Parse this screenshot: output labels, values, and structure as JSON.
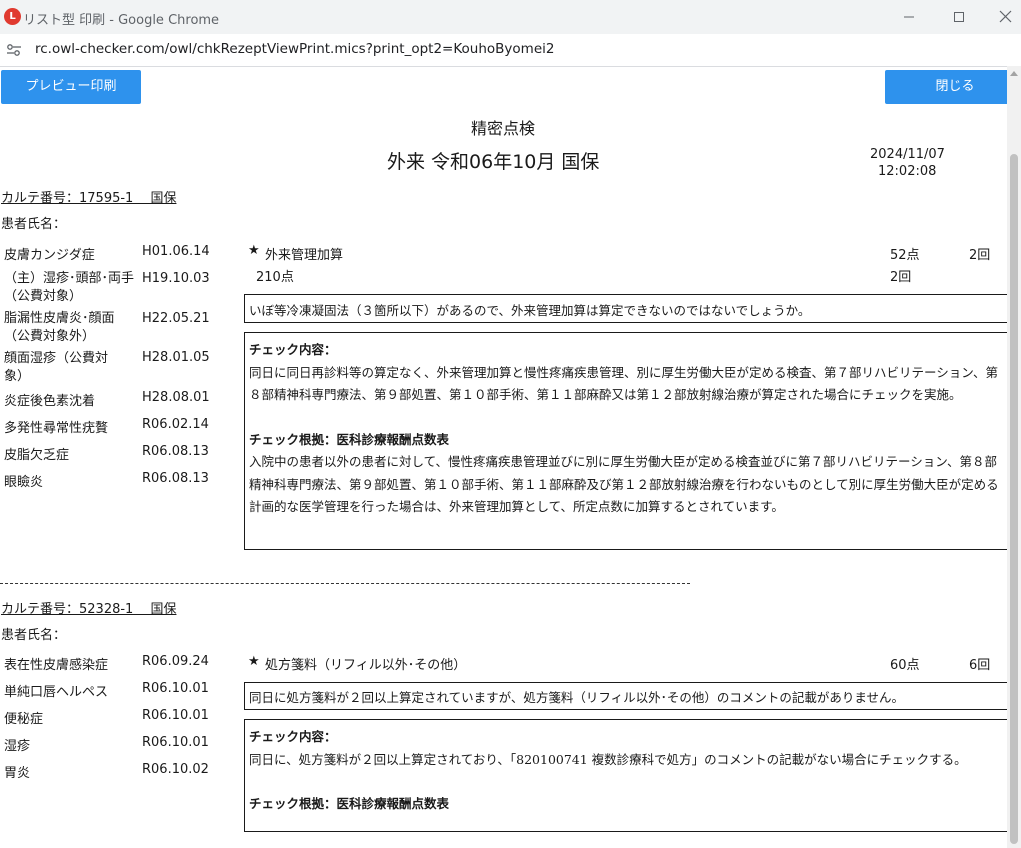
{
  "window": {
    "title": "リスト型 印刷 - Google Chrome",
    "favicon_text": "L"
  },
  "urlbar": {
    "url": "rc.owl-checker.com/owl/chkRezeptViewPrint.mics?print_opt2=KouhoByomei2"
  },
  "toolbar": {
    "preview_label": "プレビュー印刷",
    "close_label": "閉じる"
  },
  "report": {
    "title": "精密点検",
    "subtitle": "外来 令和06年10月 国保",
    "date": "2024/11/07",
    "time": "12:02:08"
  },
  "patients": [
    {
      "karte": "カルテ番号：17595-1　 国保",
      "name_label": "患者氏名：",
      "diseases": [
        {
          "name": "皮膚カンジダ症",
          "date": "H01.06.14"
        },
        {
          "name": "（主）湿疹･頭部･両手（公費対象）",
          "date": "H19.10.03"
        },
        {
          "name": "脂漏性皮膚炎･顔面（公費対象外）",
          "date": "H22.05.21"
        },
        {
          "name": "顔面湿疹（公費対象）",
          "date": "H28.01.05"
        },
        {
          "name": "炎症後色素沈着",
          "date": "H28.08.01"
        },
        {
          "name": "多発性尋常性疣贅",
          "date": "R06.02.14"
        },
        {
          "name": "皮脂欠乏症",
          "date": "R06.08.13"
        },
        {
          "name": "眼瞼炎",
          "date": "R06.08.13"
        }
      ],
      "item": {
        "star": "★",
        "name": "外来管理加算",
        "points": "52点",
        "count": "2回",
        "sub_points": "210点",
        "sub_count": "2回"
      },
      "message": "いぼ等冷凍凝固法（３箇所以下）があるので、外来管理加算は算定できないのではないでしょうか。",
      "check_title": "チェック内容：",
      "check_text": "同日に同日再診料等の算定なく、外来管理加算と慢性疼痛疾患管理、別に厚生労働大臣が定める検査、第７部リハビリテーション、第８部精神科専門療法、第９部処置、第１０部手術、第１１部麻酔又は第１２部放射線治療が算定された場合にチェックを実施。",
      "basis_title": "チェック根拠：医科診療報酬点数表",
      "basis_text": "入院中の患者以外の患者に対して、慢性疼痛疾患管理並びに別に厚生労働大臣が定める検査並びに第７部リハビリテーション、第８部精神科専門療法、第９部処置、第１０部手術、第１１部麻酔及び第１２部放射線治療を行わないものとして別に厚生労働大臣が定める計画的な医学管理を行った場合は、外来管理加算として、所定点数に加算するとされています。"
    },
    {
      "karte": "カルテ番号：52328-1　 国保",
      "name_label": "患者氏名：",
      "diseases": [
        {
          "name": "表在性皮膚感染症",
          "date": "R06.09.24"
        },
        {
          "name": "単純口唇ヘルペス",
          "date": "R06.10.01"
        },
        {
          "name": "便秘症",
          "date": "R06.10.01"
        },
        {
          "name": "湿疹",
          "date": "R06.10.01"
        },
        {
          "name": "胃炎",
          "date": "R06.10.02"
        }
      ],
      "item": {
        "star": "★",
        "name": "処方箋料（リフィル以外･その他）",
        "points": "60点",
        "count": "6回"
      },
      "message": "同日に処方箋料が２回以上算定されていますが、処方箋料（リフィル以外･その他）のコメントの記載がありません。",
      "check_title": "チェック内容：",
      "check_text": "同日に、処方箋料が２回以上算定されており、「820100741 複数診療科で処方」のコメントの記載がない場合にチェックする。",
      "basis_title": "チェック根拠：医科診療報酬点数表"
    }
  ]
}
